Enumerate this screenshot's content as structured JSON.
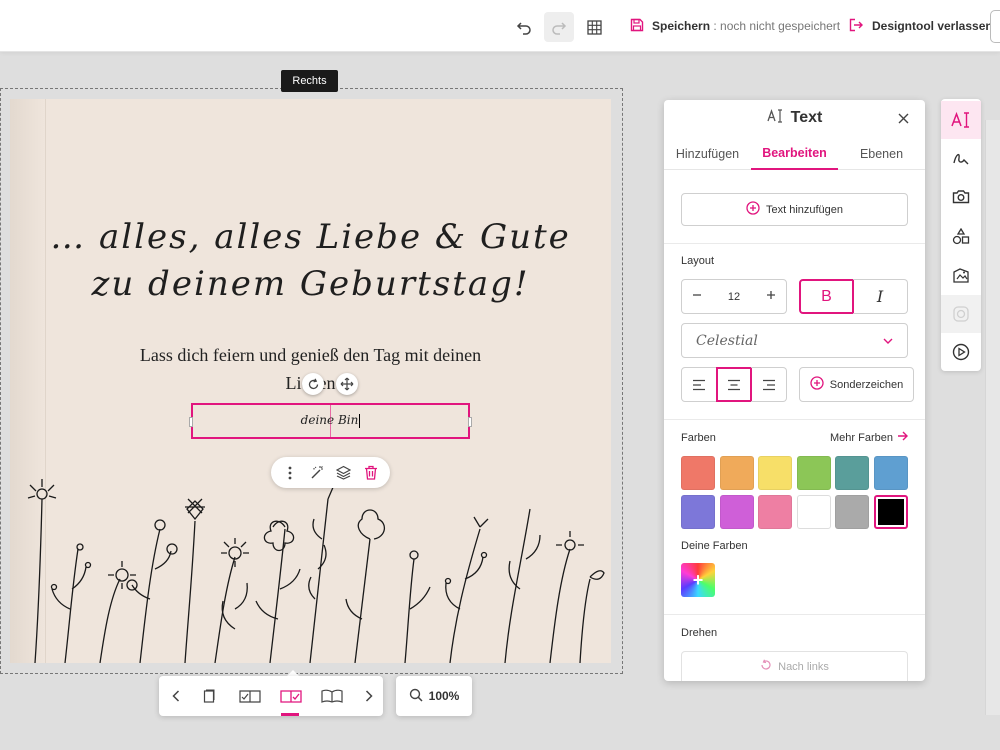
{
  "topbar": {
    "save_label": "Speichern",
    "save_status": ": noch nicht gespeichert",
    "leave_label": "Designtool verlassen",
    "icons": [
      "undo-icon",
      "redo-icon",
      "grid-icon",
      "save-icon",
      "exit-icon"
    ]
  },
  "canvas": {
    "page_tag": "Rechts",
    "line1": "… alles, alles Liebe & Gute",
    "line2": "zu deinem Geburtstag!",
    "body1": "Lass dich feiern und genieß den Tag mit deinen",
    "body2": "Lieben",
    "selected_text": "deine Bin"
  },
  "bottom": {
    "zoom": "100%"
  },
  "panel": {
    "title": "Text",
    "tabs": [
      {
        "label": "Hinzufügen",
        "active": false
      },
      {
        "label": "Bearbeiten",
        "active": true
      },
      {
        "label": "Ebenen",
        "active": false
      }
    ],
    "add_text_label": "Text hinzufügen",
    "layout_label": "Layout",
    "font_size": "12",
    "bold_label": "B",
    "italic_label": "I",
    "font_name": "Celestial",
    "special_chars_label": "Sonderzeichen",
    "colors_label": "Farben",
    "more_colors_label": "Mehr Farben",
    "colors": [
      "#ef7868",
      "#f0aa5a",
      "#f7df68",
      "#8cc657",
      "#5a9e9b",
      "#5f9fd1",
      "#7d77d9",
      "#cf5fd8",
      "#ee7fa3",
      "#ffffff",
      "#aaaaaa",
      "#000000"
    ],
    "selected_color": "#000000",
    "own_colors_label": "Deine Farben",
    "rotate_label": "Drehen",
    "rotate_left_label": "Nach links"
  },
  "accent_color": "#e1157e"
}
